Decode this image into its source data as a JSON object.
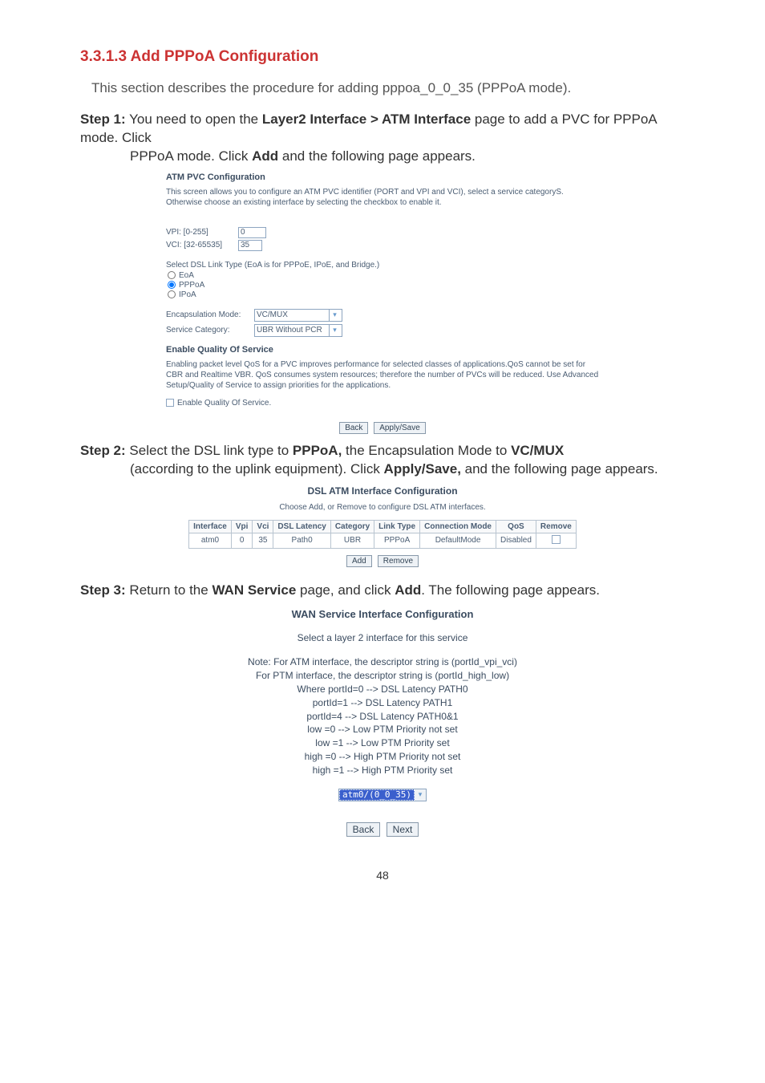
{
  "heading": "3.3.1.3 Add PPPoA Configuration",
  "intro": "This section describes the procedure for adding pppoa_0_0_35 (PPPoA mode).",
  "step1": {
    "label": "Step 1:",
    "line1": "You need to open the ",
    "bold1": "Layer2 Interface > ATM Interface",
    "mid1": " page to add a PVC for PPPoA mode. Click ",
    "bold2": "Add",
    "end1": " and the following page appears."
  },
  "screenshot1": {
    "title": "ATM PVC Configuration",
    "desc": "This screen allows you to configure an ATM PVC identifier (PORT and VPI and VCI), select a service categoryS. Otherwise choose an existing interface by selecting the checkbox to enable it.",
    "vpi_label": "VPI: [0-255]",
    "vpi_value": "0",
    "vci_label": "VCI: [32-65535]",
    "vci_value": "35",
    "link_type_title": "Select DSL Link Type (EoA is for PPPoE, IPoE, and Bridge.)",
    "radio_eoa": "EoA",
    "radio_pppoa": "PPPoA",
    "radio_ipoa": "IPoA",
    "encap_label": "Encapsulation Mode:",
    "encap_value": "VC/MUX",
    "svc_label": "Service Category:",
    "svc_value": "UBR Without PCR",
    "qos_title": "Enable Quality Of Service",
    "qos_desc": "Enabling packet level QoS for a PVC improves performance for selected classes of applications.QoS cannot be set for CBR and Realtime VBR. QoS consumes system resources; therefore the number of PVCs will be reduced. Use Advanced Setup/Quality of Service to assign priorities for the applications.",
    "qos_chk": "Enable Quality Of Service.",
    "btn_back": "Back",
    "btn_apply": "Apply/Save"
  },
  "step2": {
    "label": "Step 2:",
    "text_a": "Select the DSL link type to ",
    "bold_a": "PPPoA,",
    "text_b": " the Encapsulation Mode to ",
    "bold_b": "VC/MUX",
    "text_c": " (according to the uplink equipment). Click ",
    "bold_c": "Apply/Save,",
    "text_d": " and the following page appears."
  },
  "screenshot2": {
    "title": "DSL ATM Interface Configuration",
    "sub": "Choose Add, or Remove to configure DSL ATM interfaces.",
    "headers": [
      "Interface",
      "Vpi",
      "Vci",
      "DSL Latency",
      "Category",
      "Link Type",
      "Connection Mode",
      "QoS",
      "Remove"
    ],
    "row": [
      "atm0",
      "0",
      "35",
      "Path0",
      "UBR",
      "PPPoA",
      "DefaultMode",
      "Disabled"
    ],
    "btn_add": "Add",
    "btn_remove": "Remove"
  },
  "step3": {
    "label": "Step 3:",
    "text_a": "Return to the ",
    "bold_a": "WAN Service",
    "text_b": " page, and click ",
    "bold_b": "Add",
    "text_c": ". The following page appears."
  },
  "screenshot3": {
    "title": "WAN Service Interface Configuration",
    "sub": "Select a layer 2 interface for this service",
    "lines": [
      "Note: For ATM interface, the descriptor string is (portId_vpi_vci)",
      "For PTM interface, the descriptor string is (portId_high_low)",
      "Where portId=0 --> DSL Latency PATH0",
      "portId=1 --> DSL Latency PATH1",
      "portId=4 --> DSL Latency PATH0&1",
      "low =0 --> Low PTM Priority not set",
      "low =1 --> Low PTM Priority set",
      "high =0 --> High PTM Priority not set",
      "high =1 --> High PTM Priority set"
    ],
    "select_value": "atm0/(0_0_35)",
    "btn_back": "Back",
    "btn_next": "Next"
  },
  "page_num": "48"
}
